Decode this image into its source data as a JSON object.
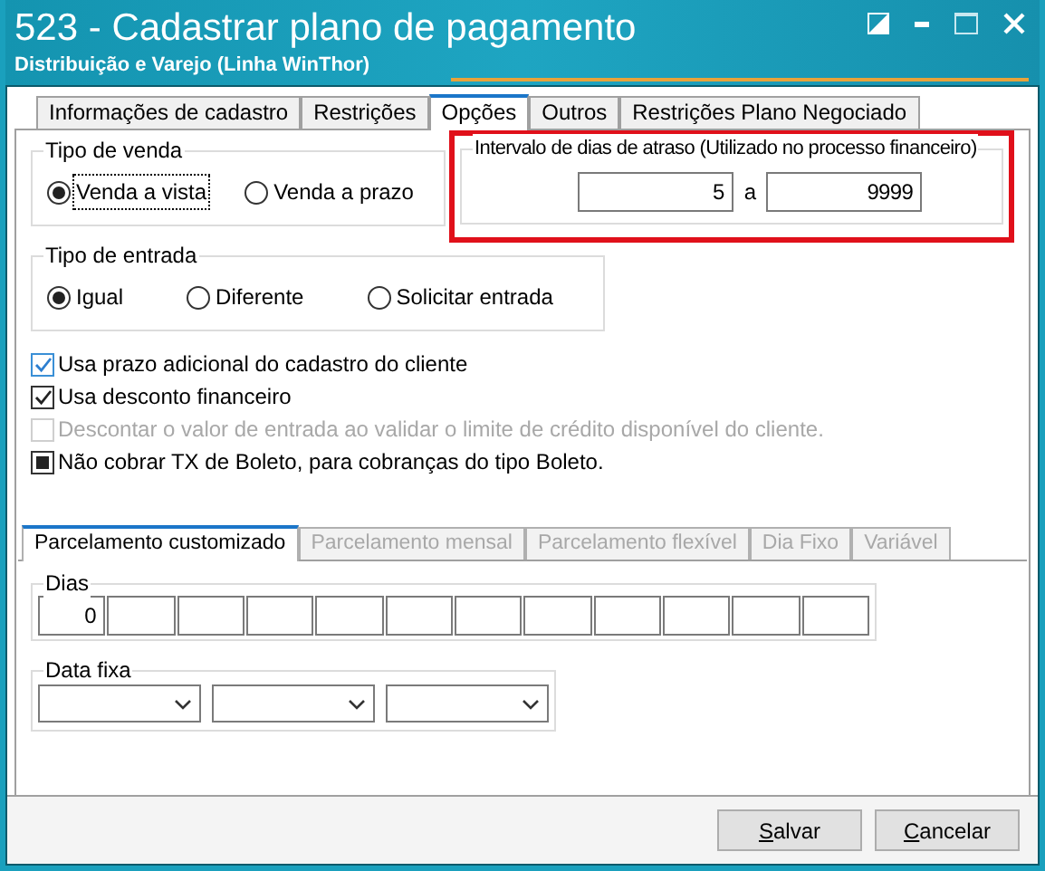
{
  "window": {
    "title": "523 - Cadastrar plano de pagamento",
    "subtitle": "Distribuição e Varejo (Linha WinThor)"
  },
  "tabs": [
    {
      "label": "Informações de cadastro",
      "selected": false
    },
    {
      "label": "Restrições",
      "selected": false
    },
    {
      "label": "Opções",
      "selected": true
    },
    {
      "label": "Outros",
      "selected": false
    },
    {
      "label": "Restrições Plano Negociado",
      "selected": false
    }
  ],
  "tipo_venda": {
    "title": "Tipo de venda",
    "options": [
      {
        "label": "Venda a vista",
        "selected": true
      },
      {
        "label": "Venda a prazo",
        "selected": false
      }
    ]
  },
  "intervalo": {
    "title": "Intervalo de dias de atraso (Utilizado no processo financeiro)",
    "from": "5",
    "separator": "a",
    "to": "9999"
  },
  "tipo_entrada": {
    "title": "Tipo de entrada",
    "options": [
      {
        "label": "Igual",
        "selected": true
      },
      {
        "label": "Diferente",
        "selected": false
      },
      {
        "label": "Solicitar entrada",
        "selected": false
      }
    ]
  },
  "checkboxes": [
    {
      "label": "Usa prazo adicional do cadastro do cliente",
      "checked": true,
      "disabled": false,
      "kind": "check"
    },
    {
      "label": "Usa desconto financeiro",
      "checked": true,
      "disabled": false,
      "kind": "check"
    },
    {
      "label": "Descontar o valor de entrada ao validar o limite de crédito disponível do cliente.",
      "checked": false,
      "disabled": true,
      "kind": "check"
    },
    {
      "label": "Não cobrar TX de Boleto, para cobranças do tipo Boleto.",
      "checked": true,
      "disabled": false,
      "kind": "square"
    }
  ],
  "sub_tabs": [
    {
      "label": "Parcelamento customizado",
      "selected": true,
      "disabled": false
    },
    {
      "label": "Parcelamento mensal",
      "selected": false,
      "disabled": true
    },
    {
      "label": "Parcelamento flexível",
      "selected": false,
      "disabled": true
    },
    {
      "label": "Dia Fixo",
      "selected": false,
      "disabled": true
    },
    {
      "label": "Variável",
      "selected": false,
      "disabled": true
    }
  ],
  "dias": {
    "title": "Dias",
    "inputs": [
      {
        "kind": "filled",
        "value": "0"
      },
      {
        "kind": "empty"
      },
      {
        "kind": "empty"
      },
      {
        "kind": "empty"
      },
      {
        "kind": "empty"
      },
      {
        "kind": "empty"
      },
      {
        "kind": "empty"
      },
      {
        "kind": "empty"
      },
      {
        "kind": "empty"
      },
      {
        "kind": "empty"
      },
      {
        "kind": "empty"
      },
      {
        "kind": "empty"
      }
    ]
  },
  "data_fixa": {
    "title": "Data fixa",
    "dropdowns": [
      {
        "kind": "select"
      },
      {
        "kind": "select"
      },
      {
        "kind": "select"
      }
    ]
  },
  "buttons": [
    {
      "label": "Salvar"
    },
    {
      "label": "Cancelar"
    }
  ]
}
